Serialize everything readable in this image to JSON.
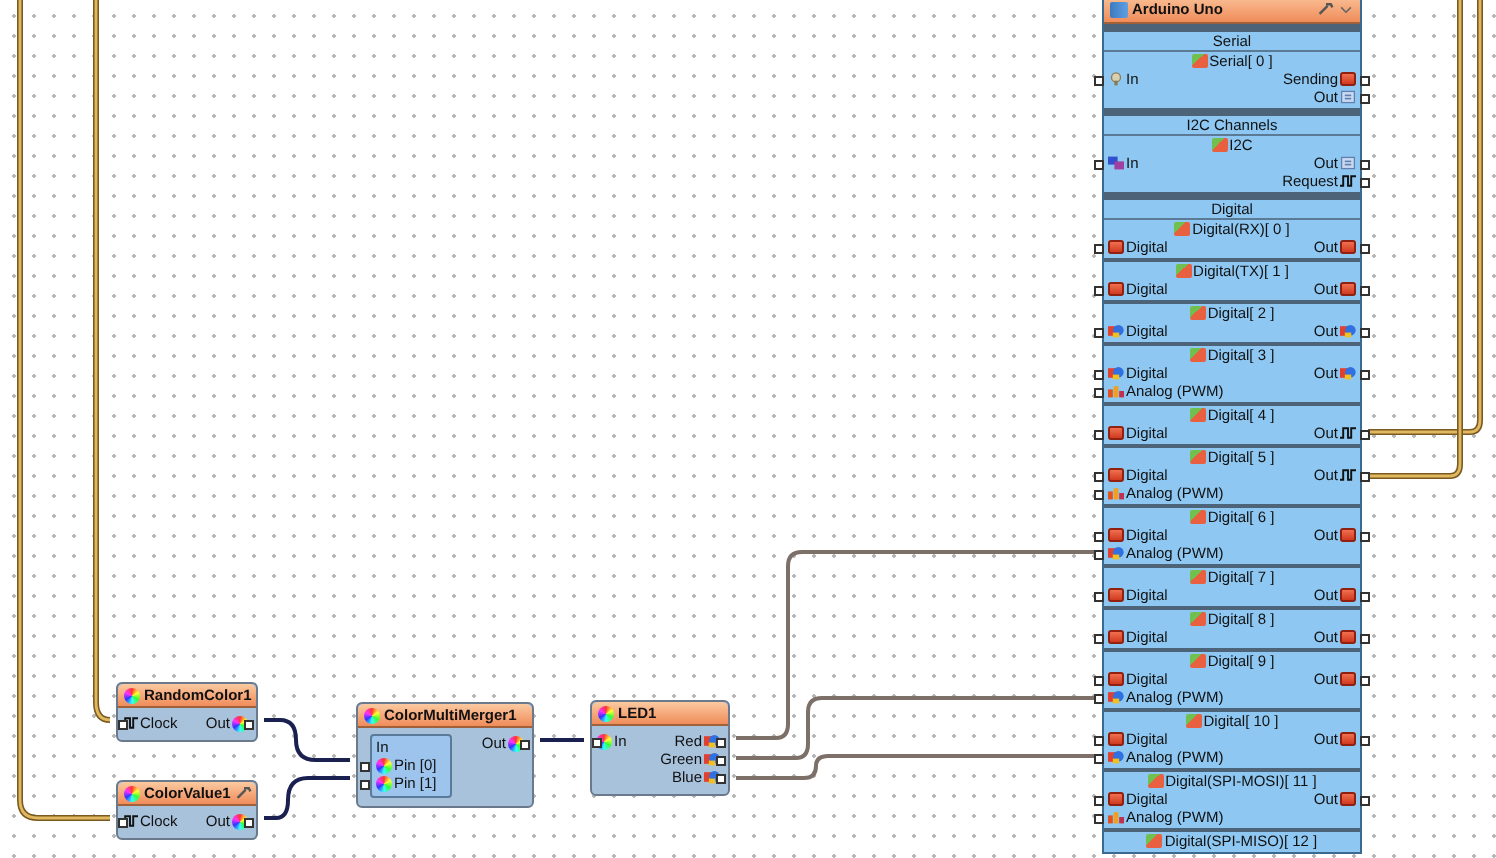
{
  "arduino": {
    "title": "Arduino Uno",
    "groups": [
      {
        "title": "Serial",
        "channels": [
          {
            "name": "Serial[ 0 ]",
            "rows": [
              {
                "in": {
                  "label": "In",
                  "kind": "serial"
                },
                "out": {
                  "label": "Sending",
                  "kind": "digital"
                }
              },
              {
                "out": {
                  "label": "Out",
                  "kind": "data"
                }
              }
            ]
          }
        ]
      },
      {
        "title": "I2C Channels",
        "channels": [
          {
            "name": "I2C",
            "rows": [
              {
                "in": {
                  "label": "In",
                  "kind": "i2c"
                },
                "out": {
                  "label": "Out",
                  "kind": "data"
                }
              },
              {
                "out": {
                  "label": "Request",
                  "kind": "clock"
                }
              }
            ]
          }
        ]
      },
      {
        "title": "Digital",
        "channels": [
          {
            "name": "Digital(RX)[ 0 ]",
            "rows": [
              {
                "in": {
                  "label": "Digital",
                  "kind": "digital"
                },
                "out": {
                  "label": "Out",
                  "kind": "digital"
                }
              }
            ]
          },
          {
            "name": "Digital(TX)[ 1 ]",
            "rows": [
              {
                "in": {
                  "label": "Digital",
                  "kind": "digital"
                },
                "out": {
                  "label": "Out",
                  "kind": "digital"
                }
              }
            ]
          },
          {
            "name": "Digital[ 2 ]",
            "rows": [
              {
                "in": {
                  "label": "Digital",
                  "kind": "rgb"
                },
                "out": {
                  "label": "Out",
                  "kind": "rgb"
                }
              }
            ]
          },
          {
            "name": "Digital[ 3 ]",
            "rows": [
              {
                "in": {
                  "label": "Digital",
                  "kind": "rgb"
                },
                "out": {
                  "label": "Out",
                  "kind": "rgb"
                }
              },
              {
                "in": {
                  "label": "Analog (PWM)",
                  "kind": "analog"
                }
              }
            ]
          },
          {
            "name": "Digital[ 4 ]",
            "rows": [
              {
                "in": {
                  "label": "Digital",
                  "kind": "digital"
                },
                "out": {
                  "label": "Out",
                  "kind": "clock"
                }
              }
            ]
          },
          {
            "name": "Digital[ 5 ]",
            "rows": [
              {
                "in": {
                  "label": "Digital",
                  "kind": "digital"
                },
                "out": {
                  "label": "Out",
                  "kind": "clock"
                }
              },
              {
                "in": {
                  "label": "Analog (PWM)",
                  "kind": "analog"
                }
              }
            ]
          },
          {
            "name": "Digital[ 6 ]",
            "rows": [
              {
                "in": {
                  "label": "Digital",
                  "kind": "digital"
                },
                "out": {
                  "label": "Out",
                  "kind": "digital"
                }
              },
              {
                "in": {
                  "label": "Analog (PWM)",
                  "kind": "rgb"
                }
              }
            ]
          },
          {
            "name": "Digital[ 7 ]",
            "rows": [
              {
                "in": {
                  "label": "Digital",
                  "kind": "digital"
                },
                "out": {
                  "label": "Out",
                  "kind": "digital"
                }
              }
            ]
          },
          {
            "name": "Digital[ 8 ]",
            "rows": [
              {
                "in": {
                  "label": "Digital",
                  "kind": "digital"
                },
                "out": {
                  "label": "Out",
                  "kind": "digital"
                }
              }
            ]
          },
          {
            "name": "Digital[ 9 ]",
            "rows": [
              {
                "in": {
                  "label": "Digital",
                  "kind": "digital"
                },
                "out": {
                  "label": "Out",
                  "kind": "digital"
                }
              },
              {
                "in": {
                  "label": "Analog (PWM)",
                  "kind": "rgb"
                }
              }
            ]
          },
          {
            "name": "Digital[ 10 ]",
            "rows": [
              {
                "in": {
                  "label": "Digital",
                  "kind": "digital"
                },
                "out": {
                  "label": "Out",
                  "kind": "digital"
                }
              },
              {
                "in": {
                  "label": "Analog (PWM)",
                  "kind": "rgb"
                }
              }
            ]
          },
          {
            "name": "Digital(SPI-MOSI)[ 11 ]",
            "rows": [
              {
                "in": {
                  "label": "Digital",
                  "kind": "digital"
                },
                "out": {
                  "label": "Out",
                  "kind": "digital"
                }
              },
              {
                "in": {
                  "label": "Analog (PWM)",
                  "kind": "analog"
                }
              }
            ]
          },
          {
            "name": "Digital(SPI-MISO)[ 12 ]"
          }
        ]
      }
    ]
  },
  "components": [
    {
      "title": "RandomColor1",
      "tool": false,
      "rows": [
        {
          "in": {
            "label": "Clock",
            "kind": "clock"
          },
          "out": {
            "label": "Out",
            "kind": "color"
          }
        }
      ]
    },
    {
      "title": "ColorValue1",
      "tool": true,
      "rows": [
        {
          "in": {
            "label": "Clock",
            "kind": "clock"
          },
          "out": {
            "label": "Out",
            "kind": "color"
          }
        }
      ]
    },
    {
      "title": "ColorMultiMerger1",
      "tool": false,
      "inputs_label": "In",
      "inputs": [
        {
          "label": "Pin [0]",
          "kind": "color"
        },
        {
          "label": "Pin [1]",
          "kind": "color"
        }
      ],
      "rows": [
        {
          "out": {
            "label": "Out",
            "kind": "color"
          }
        }
      ]
    },
    {
      "title": "LED1",
      "tool": false,
      "rows": [
        {
          "in": {
            "label": "In",
            "kind": "color"
          },
          "out": {
            "label": "Red",
            "kind": "rgb"
          }
        },
        {
          "out": {
            "label": "Green",
            "kind": "rgb"
          }
        },
        {
          "out": {
            "label": "Blue",
            "kind": "rgb"
          }
        }
      ]
    }
  ]
}
